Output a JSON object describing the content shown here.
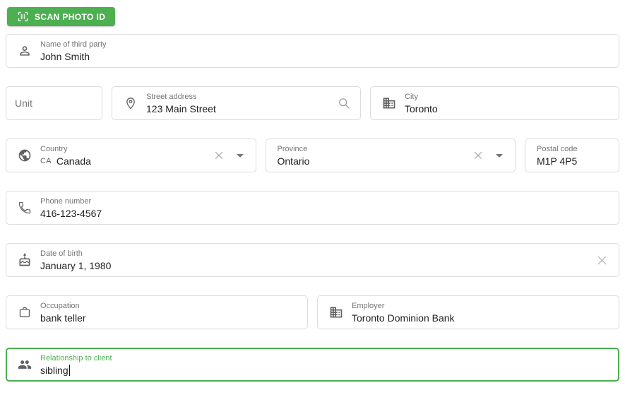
{
  "scan_button": {
    "label": "SCAN PHOTO ID"
  },
  "fields": {
    "name_of_third_party": {
      "label": "Name of third party",
      "value": "John Smith"
    },
    "unit": {
      "placeholder": "Unit",
      "value": ""
    },
    "street_address": {
      "label": "Street address",
      "value": "123 Main Street"
    },
    "city": {
      "label": "City",
      "value": "Toronto"
    },
    "country": {
      "label": "Country",
      "code": "CA",
      "value": "Canada"
    },
    "province": {
      "label": "Province",
      "value": "Ontario"
    },
    "postal_code": {
      "label": "Postal code",
      "value": "M1P 4P5"
    },
    "phone_number": {
      "label": "Phone number",
      "value": "416-123-4567"
    },
    "date_of_birth": {
      "label": "Date of birth",
      "value": "January 1, 1980"
    },
    "occupation": {
      "label": "Occupation",
      "value": "bank teller"
    },
    "employer": {
      "label": "Employer",
      "value": "Toronto Dominion Bank"
    },
    "relationship_to_client": {
      "label": "Relationship to client",
      "value": "sibling",
      "focused": true
    }
  },
  "icons": {
    "scan_button": "barcode-scan",
    "name_of_third_party": "person-outline",
    "street_address_left": "location-pin",
    "street_address_right": "search",
    "city": "building",
    "country": "globe",
    "country_trailing": [
      "clear-x",
      "dropdown-arrow"
    ],
    "province_trailing": [
      "clear-x",
      "dropdown-arrow"
    ],
    "phone_number": "phone",
    "date_of_birth": "birthday-cake",
    "date_of_birth_trailing": "clear-x",
    "occupation": "briefcase",
    "employer": "building",
    "relationship_to_client": "people-group"
  },
  "colors": {
    "accent_green": "#4caf50",
    "field_border": "#dadce0",
    "label_gray": "#757575",
    "value_dark": "#212121",
    "icon_gray": "#616161"
  }
}
